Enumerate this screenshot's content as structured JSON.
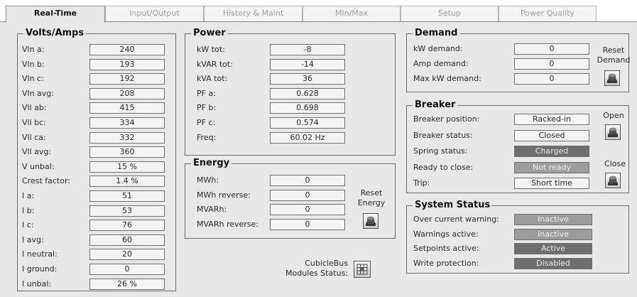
{
  "tabs": [
    "Real-Time",
    "Input/Output",
    "History & Maint",
    "Min/Max",
    "Setup",
    "Power Quality"
  ],
  "volts_amps": {
    "title": "Volts/Amps",
    "rows": [
      {
        "label": "Vln a:",
        "value": "240"
      },
      {
        "label": "Vln b:",
        "value": "193"
      },
      {
        "label": "Vln c:",
        "value": "192"
      },
      {
        "label": "Vln avg:",
        "value": "208"
      },
      {
        "label": "Vll ab:",
        "value": "415"
      },
      {
        "label": "Vll bc:",
        "value": "334"
      },
      {
        "label": "Vll ca:",
        "value": "332"
      },
      {
        "label": "Vll avg:",
        "value": "360"
      },
      {
        "label": "V unbal:",
        "value": "15 %"
      },
      {
        "label": "Crest factor:",
        "value": "1.4 %"
      },
      {
        "label": "I a:",
        "value": "51"
      },
      {
        "label": "I b:",
        "value": "53"
      },
      {
        "label": "I c:",
        "value": "76"
      },
      {
        "label": "I avg:",
        "value": "60"
      },
      {
        "label": "I neutral:",
        "value": "20"
      },
      {
        "label": "I ground:",
        "value": "0"
      },
      {
        "label": "I unbal:",
        "value": "26 %"
      }
    ]
  },
  "power": {
    "title": "Power",
    "rows": [
      {
        "label": "kW tot:",
        "value": "-8"
      },
      {
        "label": "kVAR tot:",
        "value": "-14"
      },
      {
        "label": "kVA tot:",
        "value": "36"
      },
      {
        "label": "PF a:",
        "value": "0.628"
      },
      {
        "label": "PF b:",
        "value": "0.698"
      },
      {
        "label": "PF c:",
        "value": "0.574"
      },
      {
        "label": "Freq:",
        "value": "60.02 Hz"
      }
    ]
  },
  "energy": {
    "title": "Energy",
    "rows": [
      {
        "label": "MWh:",
        "value": "0"
      },
      {
        "label": "MWh reverse:",
        "value": "0"
      },
      {
        "label": "MVARh:",
        "value": "0"
      },
      {
        "label": "MVARh reverse:",
        "value": "0"
      }
    ],
    "reset_label_1": "Reset",
    "reset_label_2": "Energy",
    "reset_icon": "pushbutton-icon"
  },
  "cubicle": {
    "label_1": "CubicleBus",
    "label_2": "Modules Status:",
    "icon": "modules-grid-icon"
  },
  "demand": {
    "title": "Demand",
    "rows": [
      {
        "label": "kW demand:",
        "value": "0"
      },
      {
        "label": "Amp demand:",
        "value": "0"
      },
      {
        "label": "Max kW demand:",
        "value": "0"
      }
    ],
    "reset_label_1": "Reset",
    "reset_label_2": "Demand",
    "reset_icon": "pushbutton-icon"
  },
  "breaker": {
    "title": "Breaker",
    "rows": [
      {
        "label": "Breaker position:",
        "value": "Racked-in",
        "style": "light"
      },
      {
        "label": "Breaker status:",
        "value": "Closed",
        "style": "light"
      },
      {
        "label": "Spring status:",
        "value": "Charged",
        "style": "dark"
      },
      {
        "label": "Ready to close:",
        "value": "Not ready",
        "style": "mid"
      },
      {
        "label": "Trip:",
        "value": "Short time",
        "style": "light"
      }
    ],
    "open_label": "Open",
    "close_label": "Close",
    "button_icon": "pushbutton-icon"
  },
  "system_status": {
    "title": "System Status",
    "rows": [
      {
        "label": "Over current warning:",
        "value": "Inactive",
        "style": "mid"
      },
      {
        "label": "Warnings active:",
        "value": "Inactive",
        "style": "mid"
      },
      {
        "label": "Setpoints active:",
        "value": "Active",
        "style": "dark"
      },
      {
        "label": "Write protection:",
        "value": "Disabled",
        "style": "dark"
      }
    ]
  },
  "colors": {
    "panel": "#e8e8e8",
    "field": "#f4f4f4",
    "status_dark": "#6e6e6e",
    "status_mid": "#9c9c9c",
    "border": "#6a6a6a"
  }
}
